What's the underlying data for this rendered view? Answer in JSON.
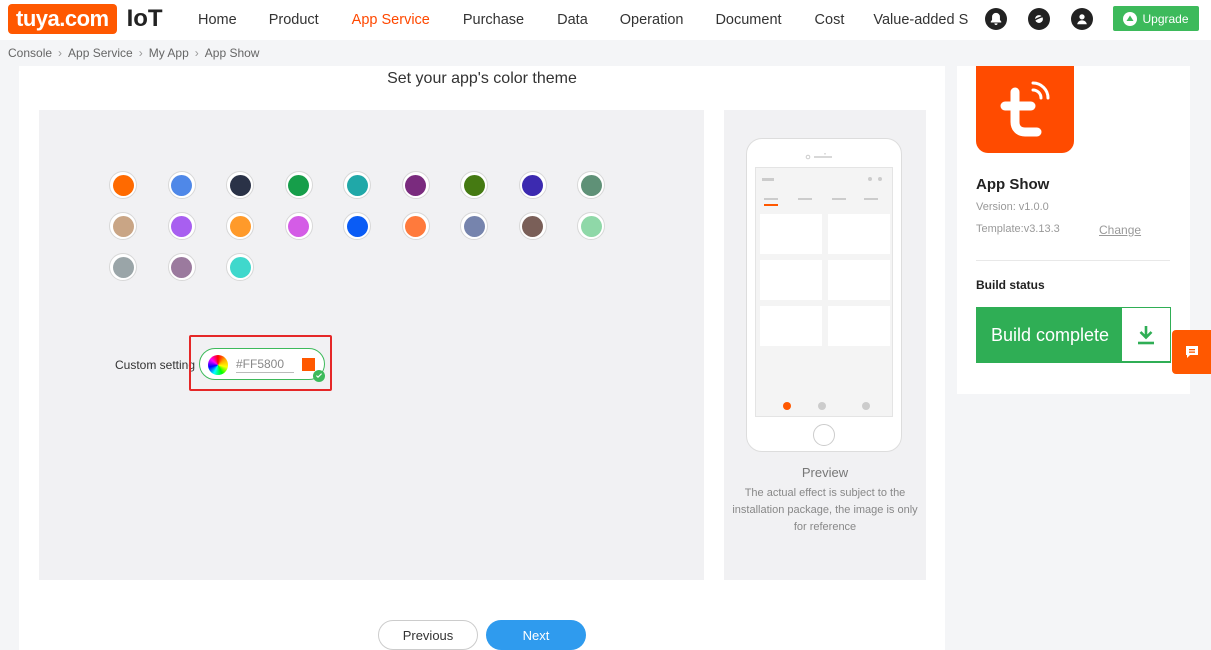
{
  "brand": {
    "logo_text": "tuya.com",
    "product": "IoT",
    "accent": "#ff5800"
  },
  "nav": {
    "items": [
      {
        "label": "Home",
        "active": false
      },
      {
        "label": "Product",
        "active": false
      },
      {
        "label": "App Service",
        "active": true
      },
      {
        "label": "Purchase",
        "active": false
      },
      {
        "label": "Data",
        "active": false
      },
      {
        "label": "Operation",
        "active": false
      },
      {
        "label": "Document",
        "active": false
      },
      {
        "label": "Cost",
        "active": false
      },
      {
        "label": "Value-added S",
        "active": false
      }
    ],
    "icons": [
      "bell-icon",
      "planet-icon",
      "user-icon"
    ],
    "upgrade_label": "Upgrade"
  },
  "breadcrumb": [
    "Console",
    "App Service",
    "My App",
    "App Show"
  ],
  "theme": {
    "title": "Set your app's color theme",
    "swatches": [
      "#ff6a00",
      "#4f88e8",
      "#2a3247",
      "#169e4a",
      "#20a8a8",
      "#7a2b7e",
      "#457a12",
      "#3c2ab0",
      "#5f9177",
      "#c9a585",
      "#a85ff0",
      "#ff9a2a",
      "#d45ce6",
      "#0a5cf5",
      "#ff7a3c",
      "#7684ad",
      "#7a5f58",
      "#8fd8a8",
      "#9aa5a8",
      "#9b7a9e",
      "#3fd8cc"
    ],
    "custom_label": "Custom setting",
    "custom_value": "#FF5800"
  },
  "preview": {
    "title": "Preview",
    "description": "The actual effect is subject to the installation package, the image is only for reference"
  },
  "buttons": {
    "previous": "Previous",
    "next": "Next"
  },
  "app": {
    "name": "App Show",
    "version": "Version: v1.0.0",
    "template": "Template:v3.13.3",
    "change_label": "Change",
    "build_status_title": "Build status",
    "build_status": "Build complete",
    "icon_color": "#ff4b00"
  }
}
